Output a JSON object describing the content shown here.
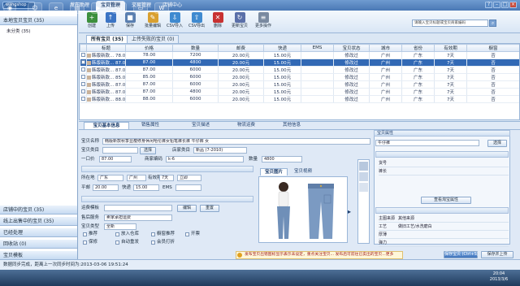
{
  "window": {
    "logo": "wangshop",
    "tabs": [
      "发布助理",
      "宝贝管理",
      "交易管理",
      "店铺中心"
    ]
  },
  "sidebar": {
    "header": "本地宝贝宝贝 (35)",
    "sub": "未分类 (35)",
    "sections": [
      "店铺中的宝贝 (35)",
      "线上出售中的宝贝 (35)",
      "已经处理",
      "回收站 (0)",
      "宝贝模板"
    ]
  },
  "toolbar": {
    "buttons": [
      {
        "label": "创建",
        "icon": "plus-icon",
        "color": "#3c8f3c",
        "glyph": "+"
      },
      {
        "label": "上传",
        "icon": "upload-icon",
        "color": "#3b74c4",
        "glyph": "↑"
      },
      {
        "label": "保存",
        "icon": "save-icon",
        "color": "#5a7fb0",
        "glyph": "■"
      },
      {
        "label": "批量编辑",
        "icon": "batch-edit-icon",
        "color": "#d9a030",
        "glyph": "✎"
      },
      {
        "label": "CSV导入",
        "icon": "csv-import-icon",
        "color": "#3f8ad0",
        "glyph": "⇩"
      },
      {
        "label": "CSV导出",
        "icon": "csv-export-icon",
        "color": "#3f8ad0",
        "glyph": "⇧"
      },
      {
        "label": "删除",
        "icon": "delete-icon",
        "color": "#c83232",
        "glyph": "✕"
      },
      {
        "label": "更新宝贝",
        "icon": "update-icon",
        "color": "#5a6fa8",
        "glyph": "↻"
      },
      {
        "label": "更多操作",
        "icon": "more-icon",
        "color": "#7a8aa0",
        "glyph": "≡"
      }
    ],
    "search_placeholder": "请输入宝贝标题或宝贝商家编码"
  },
  "list_tabs": [
    "所有宝贝 (35)",
    "上传失败的宝贝 (0)"
  ],
  "table": {
    "columns": [
      "",
      "标题",
      "价格",
      "数量",
      "邮费",
      "快递",
      "EMS",
      "宝贝状态",
      "城市",
      "省份",
      "有效期",
      "橱窗"
    ],
    "rows": [
      [
        "",
        "韩版新款... 78.00",
        "78.00",
        "7200",
        "20.00元",
        "15.00元",
        "",
        "修改过",
        "广州",
        "广东",
        "7天",
        "否"
      ],
      [
        "",
        "韩版新款... 87.00",
        "87.00",
        "4800",
        "20.00元",
        "15.00元",
        "",
        "修改过",
        "广州",
        "广东",
        "7天",
        "否"
      ],
      [
        "",
        "韩版新款... 87.00",
        "87.00",
        "6000",
        "20.00元",
        "15.00元",
        "",
        "修改过",
        "广州",
        "广东",
        "7天",
        "否"
      ],
      [
        "",
        "韩版新款... 85.00",
        "85.00",
        "6000",
        "20.00元",
        "15.00元",
        "",
        "修改过",
        "广州",
        "广东",
        "7天",
        "否"
      ],
      [
        "",
        "韩版新款... 87.00",
        "87.00",
        "6000",
        "20.00元",
        "15.00元",
        "",
        "修改过",
        "广州",
        "广东",
        "7天",
        "否"
      ],
      [
        "",
        "韩版新款... 87.00",
        "87.00",
        "4800",
        "20.00元",
        "15.00元",
        "",
        "修改过",
        "广州",
        "广东",
        "7天",
        "否"
      ],
      [
        "",
        "韩版新款... 88.00",
        "88.00",
        "6000",
        "20.00元",
        "15.00元",
        "",
        "修改过",
        "广州",
        "广东",
        "7天",
        "否"
      ]
    ],
    "selected_row": 1
  },
  "detail": {
    "tabs": [
      "宝贝基本信息",
      "销售属性",
      "宝贝描述",
      "物流运费",
      "其他信息"
    ],
    "title_label": "宝贝名称",
    "title_value": "韩版新款秋季显瘦修身休闲哈伦裤女铅笔裤长裤 牛仔裤 女",
    "category_label": "宝贝类目",
    "category_button": "选择",
    "shop_category_label": "店家类目",
    "shop_category_value": "新品 (7-2010)",
    "price_label": "一口价",
    "price_value": "87.00",
    "outer_id_label": "商家编码",
    "outer_id_value": "k-6",
    "quantity_label": "数量",
    "quantity_value": "4800",
    "location_label": "所在地",
    "province": "广东",
    "city": "广州",
    "valid_label": "有效期",
    "valid_value": "7天",
    "start_label": "开始时间",
    "start_value": "立即",
    "mail_label": "平邮",
    "mail_value": "20.00",
    "express_label": "快递",
    "express_value": "15.00",
    "ems_label": "EMS",
    "ems_value": "",
    "template_label": "运费模板",
    "template_button": "编辑",
    "template_button2": "重置",
    "shipping_section": "售后服务",
    "shipping_select": "卖家承担运费",
    "type_label": "宝贝类型",
    "type_value": "全新",
    "checks": [
      "推荐",
      "放入仓库",
      "橱窗推荐",
      "开票",
      "保修",
      "自动重发",
      "会员打折"
    ],
    "image_tabs": [
      "宝贝图片",
      "宝贝视频"
    ],
    "image_alt": "jeans"
  },
  "attributes": {
    "section_title": "宝贝属性",
    "brand_label": "牛仔裤",
    "rows": [
      {
        "k": "货号",
        "v": ""
      },
      {
        "k": "裤长",
        "v": ""
      },
      {
        "k": "主图来源",
        "v": "其他来源"
      },
      {
        "k": "工艺",
        "v": "做旧工艺/水洗磨白"
      },
      {
        "k": "厚薄",
        "v": ""
      },
      {
        "k": "弹力",
        "v": ""
      },
      {
        "k": "颜色",
        "v": ""
      }
    ],
    "select_button": "选择",
    "more_button": "查看淘宝属性"
  },
  "notice": "发布宝贝出错图标显示表示未设定，重点关注宝贝... 发布后可前往已卖出的宝贝...更多",
  "actions": {
    "save_button": "保存宝贝 (Ctrl+S)",
    "upload_button": "保存并上传"
  },
  "statusbar": "数据同步完成，距离上一次同步时间为:2013-03-06 19:51:24",
  "taskbar": {
    "time": "20:04",
    "date": "2013/3/6"
  }
}
